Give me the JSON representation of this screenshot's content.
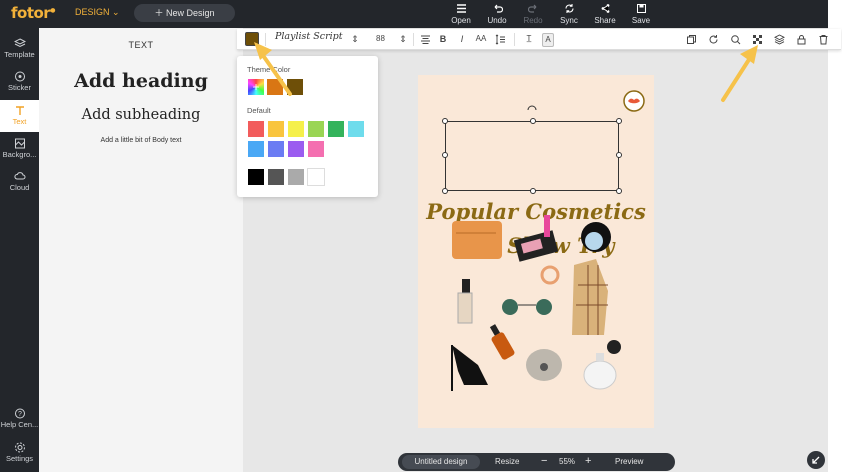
{
  "app": {
    "logo": "fotor",
    "design_menu": "DESIGN",
    "new_design": "New Design"
  },
  "top_tools": [
    {
      "label": "Open",
      "icon": "menu-icon",
      "disabled": false
    },
    {
      "label": "Undo",
      "icon": "undo-icon",
      "disabled": false
    },
    {
      "label": "Redo",
      "icon": "redo-icon",
      "disabled": true
    },
    {
      "label": "Sync",
      "icon": "sync-icon",
      "disabled": false
    },
    {
      "label": "Share",
      "icon": "share-icon",
      "disabled": false
    },
    {
      "label": "Save",
      "icon": "save-icon",
      "disabled": false
    }
  ],
  "rail": {
    "template": "Template",
    "sticker": "Sticker",
    "text": "Text",
    "background": "Backgro...",
    "cloud": "Cloud",
    "help": "Help Cen...",
    "settings": "Settings"
  },
  "panel": {
    "title": "TEXT",
    "heading": "Add heading",
    "subheading": "Add subheading",
    "body": "Add a little bit of Body text"
  },
  "textbar": {
    "current_color": "#6e4f08",
    "font": "Playlist Script",
    "size": "88"
  },
  "color_popup": {
    "theme_label": "Theme Color",
    "default_label": "Default",
    "theme_colors": [
      "#d97614",
      "#6e4f08"
    ],
    "default_colors": [
      "#f25c5c",
      "#f9c53e",
      "#f5f04b",
      "#9ad554",
      "#34b35c",
      "#6edcec",
      "#4aa8f5",
      "#6b7cf3",
      "#9b5cf0",
      "#f46fb0"
    ],
    "neutral_colors": [
      "#000000",
      "#555555",
      "#aaaaaa",
      "#ffffff"
    ]
  },
  "canvas": {
    "title_line1": "Popular Cosmetics",
    "title_line2": "You Show Try",
    "background": "#fae8d8",
    "title_color": "#8b6a14"
  },
  "bottombar": {
    "title": "Untitled design",
    "resize": "Resize",
    "zoom": "55%",
    "preview": "Preview"
  }
}
